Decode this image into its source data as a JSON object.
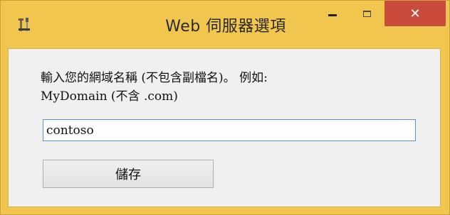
{
  "window": {
    "title": "Web 伺服器選項",
    "icon": "tools-icon",
    "controls": {
      "minimize": "minimize-icon",
      "maximize": "maximize-icon",
      "close": "close-icon",
      "close_glyph": "✕"
    },
    "colors": {
      "frame": "#f0c64e",
      "close_button": "#c94b3c",
      "input_border": "#5b8fd6"
    }
  },
  "form": {
    "prompt_line1": "輸入您的網域名稱 (不包含副檔名)。 例如:",
    "prompt_line2": "MyDomain (不含 .com)",
    "domain_value": "contoso",
    "save_label": "儲存"
  }
}
